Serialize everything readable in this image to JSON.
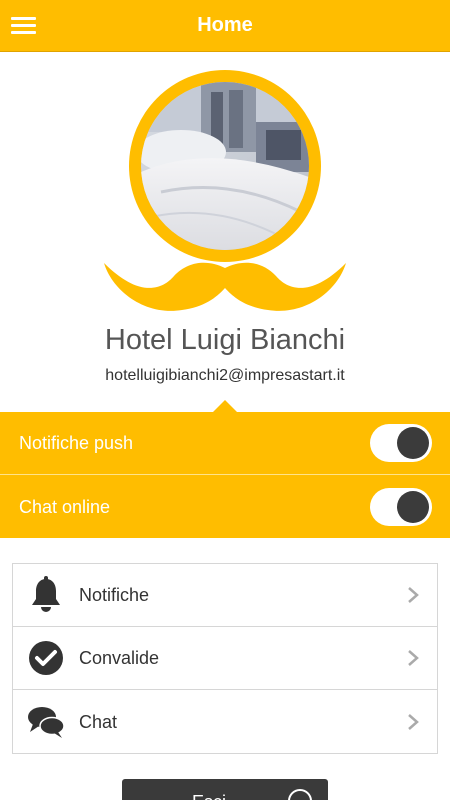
{
  "header": {
    "title": "Home",
    "menu_icon": "hamburger-menu-icon"
  },
  "profile": {
    "name": "Hotel Luigi Bianchi",
    "email": "hotelluigibianchi2@impresastart.it",
    "brand_color": "#FFBD00"
  },
  "toggles": [
    {
      "label": "Notifiche push",
      "state": "on"
    },
    {
      "label": "Chat online",
      "state": "on"
    }
  ],
  "menu_items": [
    {
      "label": "Notifiche",
      "icon": "bell-icon"
    },
    {
      "label": "Convalide",
      "icon": "check-circle-icon"
    },
    {
      "label": "Chat",
      "icon": "chat-bubbles-icon"
    }
  ],
  "bottom_button": {
    "label": "Esci",
    "icon": "power-icon"
  }
}
